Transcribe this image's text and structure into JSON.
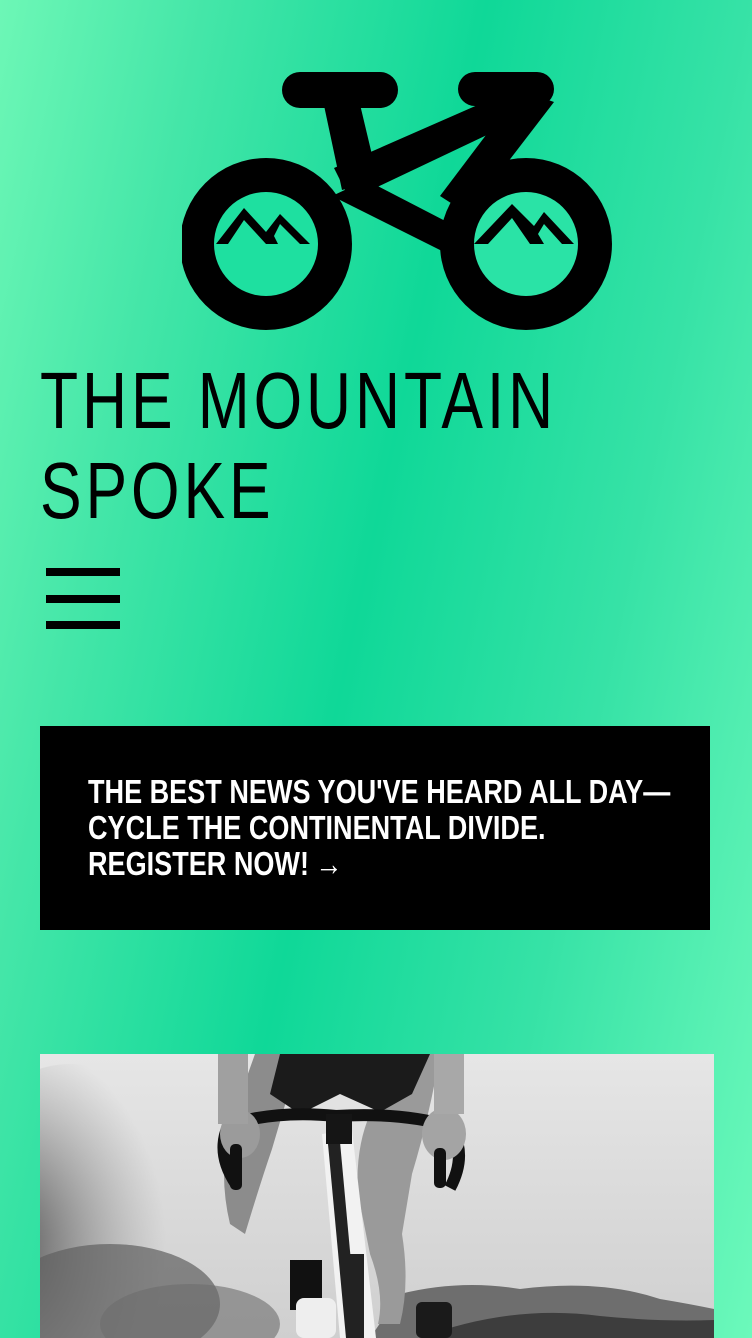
{
  "site": {
    "logo_icon": "bicycle-mountain-logo",
    "title_line1": "THE MOUNTAIN",
    "title_line2": "SPOKE",
    "menu_icon": "hamburger-menu-icon"
  },
  "promo": {
    "line1": "THE BEST NEWS YOU'VE HEARD ALL DAY—",
    "line2": "CYCLE THE CONTINENTAL DIVIDE.",
    "line3": "REGISTER NOW!",
    "arrow": "→"
  },
  "hero": {
    "image_icon": "cyclist-photo"
  },
  "colors": {
    "background_accent": "#0fd898",
    "background_light": "#6df7b6",
    "promo_background": "#000000",
    "promo_text": "#ffffff"
  }
}
